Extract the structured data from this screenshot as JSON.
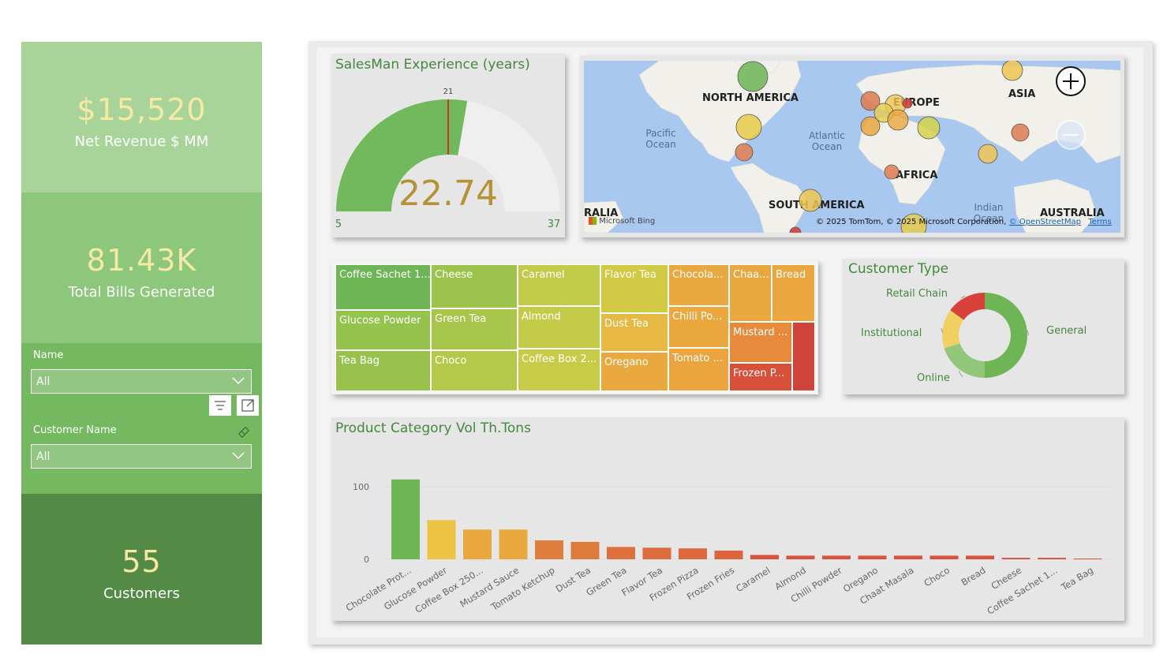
{
  "kpis": {
    "revenue": {
      "value": "$15,520",
      "label": "Net Revenue $ MM"
    },
    "bills": {
      "value": "81.43K",
      "label": "Total Bills Generated"
    },
    "customers": {
      "value": "55",
      "label": "Customers"
    }
  },
  "slicers": {
    "name": {
      "label": "Name",
      "value": "All"
    },
    "customer_name": {
      "label": "Customer Name",
      "value": "All"
    }
  },
  "gauge": {
    "title": "SalesMan Experience (years)",
    "value": "22.74",
    "min": "5",
    "max": "37",
    "target": "21",
    "min_num": 5,
    "max_num": 37,
    "value_num": 22.74,
    "target_num": 21
  },
  "map": {
    "labels": {
      "north_america": "NORTH AMERICA",
      "europe": "EUROPE",
      "asia": "ASIA",
      "africa": "AFRICA",
      "south_america": "SOUTH AMERICA",
      "australia": "AUSTRALIA",
      "australia_left": "RALIA"
    },
    "oceans": {
      "pacific": "Pacific Ocean",
      "atlantic": "Atlantic Ocean",
      "indian": "Indian Ocean"
    },
    "attribution": "© 2025 TomTom, © 2025 Microsoft Corporation,",
    "osm_link": "© OpenStreetMap",
    "terms_link": "Terms",
    "bing": "Microsoft Bing"
  },
  "treemap": {
    "cells": [
      {
        "label": "Coffee Sachet 1...",
        "color": "#6db555"
      },
      {
        "label": "Glucose Powder",
        "color": "#93c24d"
      },
      {
        "label": "Tea Bag",
        "color": "#98c24d"
      },
      {
        "label": "Cheese",
        "color": "#9cc44c"
      },
      {
        "label": "Green Tea",
        "color": "#a8c64b"
      },
      {
        "label": "Choco",
        "color": "#b4c94a"
      },
      {
        "label": "Caramel",
        "color": "#c2cb49"
      },
      {
        "label": "Almond",
        "color": "#c4cb48"
      },
      {
        "label": "Coffee Box 2...",
        "color": "#c8cb47"
      },
      {
        "label": "Flavor Tea",
        "color": "#d2c945"
      },
      {
        "label": "Dust Tea",
        "color": "#e8b942"
      },
      {
        "label": "Oregano",
        "color": "#eaa93e"
      },
      {
        "label": "Chocola...",
        "color": "#e9a940"
      },
      {
        "label": "Chilli Po...",
        "color": "#eaa83f"
      },
      {
        "label": "Tomato ...",
        "color": "#eba43e"
      },
      {
        "label": "Chaa...",
        "color": "#eba73f"
      },
      {
        "label": "Bread",
        "color": "#eba63f"
      },
      {
        "label": "Mustard ...",
        "color": "#e88a3c"
      },
      {
        "label": "Frozen P...",
        "color": "#d8503a"
      },
      {
        "label": "",
        "color": "#d0433b"
      }
    ]
  },
  "donut": {
    "title": "Customer Type",
    "segments": [
      {
        "name": "General",
        "value": 50,
        "color": "#6db555"
      },
      {
        "name": "Online",
        "value": 20,
        "color": "#92c77b"
      },
      {
        "name": "Institutional",
        "value": 15,
        "color": "#f0d060"
      },
      {
        "name": "Retail Chain",
        "value": 15,
        "color": "#d8403a"
      }
    ]
  },
  "chart_data": {
    "type": "bar",
    "title": "Product Category Vol Th.Tons",
    "xlabel": "",
    "ylabel": "",
    "ylim": [
      0,
      120
    ],
    "y_ticks": [
      "100",
      "0"
    ],
    "categories": [
      "Chocolate Prot...",
      "Glucose Powder",
      "Coffee Box 250...",
      "Mustard Sauce",
      "Tomato Ketchup",
      "Dust Tea",
      "Green Tea",
      "Flavor Tea",
      "Frozen Pizza",
      "Frozen Fries",
      "Caramel",
      "Almond",
      "Chilli Powder",
      "Oregano",
      "Chaat Masala",
      "Choco",
      "Bread",
      "Cheese",
      "Coffee Sachet 1...",
      "Tea Bag"
    ],
    "values": [
      110,
      54,
      41,
      41,
      26,
      24,
      17,
      16,
      15,
      12,
      6,
      5,
      5,
      5,
      5,
      5,
      5,
      2,
      2,
      1
    ],
    "colors": [
      "#6db555",
      "#ecc241",
      "#e8a83e",
      "#e8a83e",
      "#e07e3e",
      "#df7a3d",
      "#de703d",
      "#dd6c3d",
      "#dd693c",
      "#dc643c",
      "#d9533a",
      "#d9533a",
      "#d9533a",
      "#d9533a",
      "#d9533a",
      "#d9533a",
      "#d9533a",
      "#d8503a",
      "#d8503a",
      "#d8503a"
    ]
  }
}
